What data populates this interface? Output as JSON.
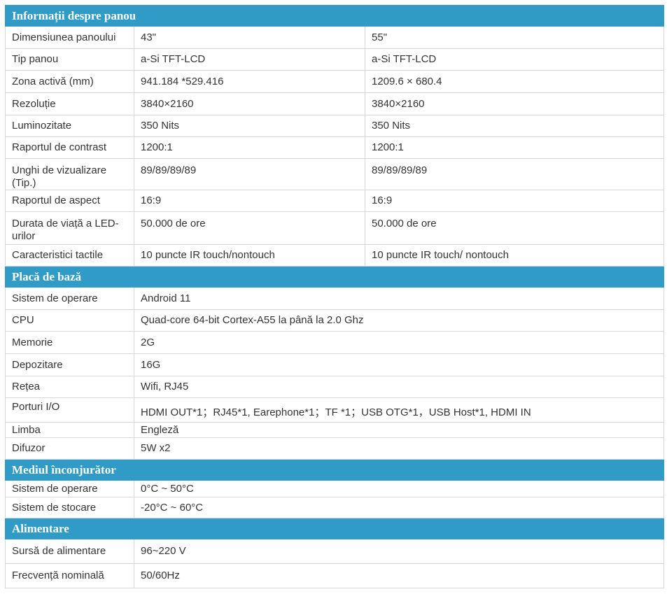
{
  "sections": {
    "panel": {
      "title": "Informații despre panou",
      "rows": [
        {
          "label": "Dimensiunea panoului",
          "v43": "43\"",
          "v55": "55\""
        },
        {
          "label": "Tip panou",
          "v43": "a-Si TFT-LCD",
          "v55": "a-Si TFT-LCD"
        },
        {
          "label": "Zona activă (mm)",
          "v43": "941.184 *529.416",
          "v55": "1209.6 × 680.4"
        },
        {
          "label": "Rezoluție",
          "v43": "3840×2160",
          "v55": "3840×2160"
        },
        {
          "label": "Luminozitate",
          "v43": "350 Nits",
          "v55": "350 Nits"
        },
        {
          "label": "Raportul de contrast",
          "v43": "1200:1",
          "v55": "1200:1"
        },
        {
          "label": "Unghi de vizualizare (Tip.)",
          "v43": "89/89/89/89",
          "v55": "89/89/89/89"
        },
        {
          "label": "Raportul de aspect",
          "v43": "16:9",
          "v55": "16:9"
        },
        {
          "label": "Durata de viață a LED-urilor",
          "v43": "50.000 de ore",
          "v55": "50.000 de ore"
        },
        {
          "label": "Caracteristici tactile",
          "v43": "10 puncte IR touch/nontouch",
          "v55": "10 puncte IR touch/ nontouch"
        }
      ]
    },
    "mainboard": {
      "title": "Placă de bază",
      "rows": [
        {
          "label": "Sistem de operare",
          "value": "Android 11"
        },
        {
          "label": "CPU",
          "value": "Quad-core 64-bit Cortex-A55 la până la 2.0 Ghz"
        },
        {
          "label": "Memorie",
          "value": "2G"
        },
        {
          "label": "Depozitare",
          "value": "16G"
        },
        {
          "label": "Rețea",
          "value": "Wifi, RJ45"
        },
        {
          "label": "Porturi I/O",
          "value": "HDMI OUT*1；RJ45*1, Earephone*1；TF *1；USB OTG*1，USB Host*1, HDMI IN"
        },
        {
          "label": "Limba",
          "value": "Engleză"
        },
        {
          "label": "Difuzor",
          "value": "5W x2"
        }
      ]
    },
    "environment": {
      "title": "Mediul înconjurător",
      "rows": [
        {
          "label": "Sistem de operare",
          "value": "0°C ~ 50°C"
        },
        {
          "label": "Sistem de stocare",
          "value": "-20°C ~ 60°C"
        }
      ]
    },
    "power": {
      "title": "Alimentare",
      "rows": [
        {
          "label": "Sursă de alimentare",
          "value": "96~220 V"
        },
        {
          "label": "Frecvență nominală",
          "value": "50/60Hz"
        }
      ]
    }
  },
  "colors": {
    "section_header_bg": "#2f9bc6",
    "section_header_text": "#ffffff",
    "border": "#d6d6d6",
    "text": "#333333"
  }
}
